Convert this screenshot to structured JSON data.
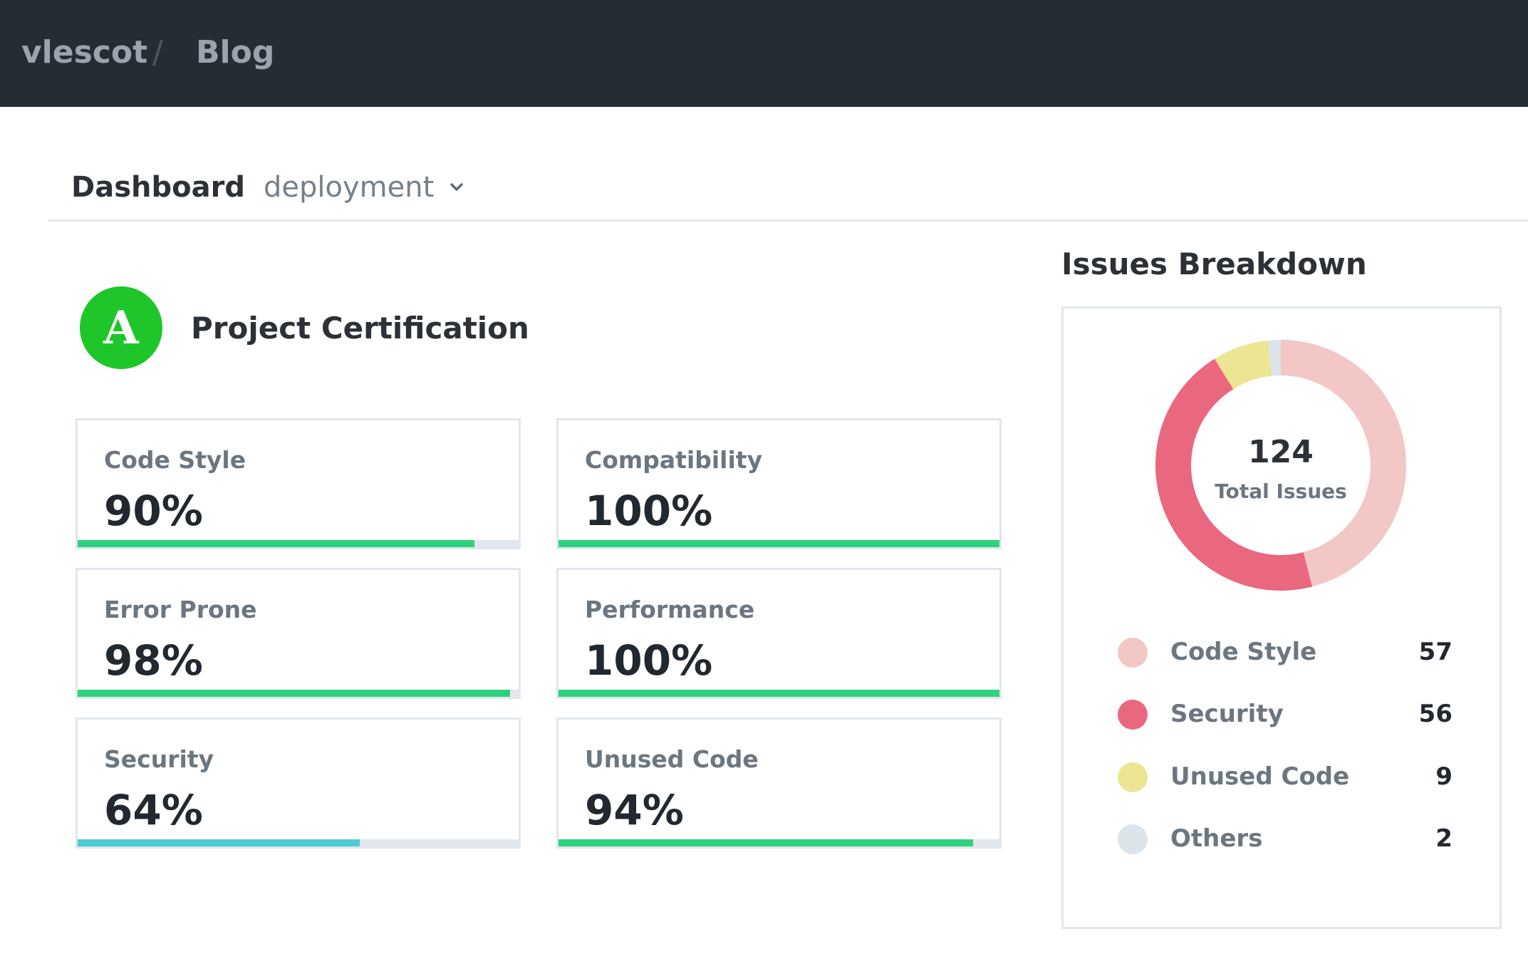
{
  "breadcrumb": {
    "owner": "vlescot",
    "separator": "/",
    "repo": "Blog"
  },
  "tabs": {
    "dashboard": "Dashboard",
    "branch": "deployment"
  },
  "certification": {
    "grade": "A",
    "title": "Project Certification",
    "grade_color": "#1ec629"
  },
  "metrics": [
    {
      "label": "Code Style",
      "value": "90%",
      "percent": 90,
      "color": "#2dd27d"
    },
    {
      "label": "Compatibility",
      "value": "100%",
      "percent": 100,
      "color": "#2dd27d"
    },
    {
      "label": "Error Prone",
      "value": "98%",
      "percent": 98,
      "color": "#2dd27d"
    },
    {
      "label": "Performance",
      "value": "100%",
      "percent": 100,
      "color": "#2dd27d"
    },
    {
      "label": "Security",
      "value": "64%",
      "percent": 64,
      "color": "#4fcbd3"
    },
    {
      "label": "Unused Code",
      "value": "94%",
      "percent": 94,
      "color": "#2dd27d"
    }
  ],
  "issues": {
    "title": "Issues Breakdown",
    "total": "124",
    "total_label": "Total Issues",
    "items": [
      {
        "label": "Code Style",
        "count": 57,
        "color": "#f2c7c5"
      },
      {
        "label": "Security",
        "count": 56,
        "color": "#e9677f"
      },
      {
        "label": "Unused Code",
        "count": 9,
        "color": "#ece593"
      },
      {
        "label": "Others",
        "count": 2,
        "color": "#dbe4ea"
      }
    ]
  }
}
